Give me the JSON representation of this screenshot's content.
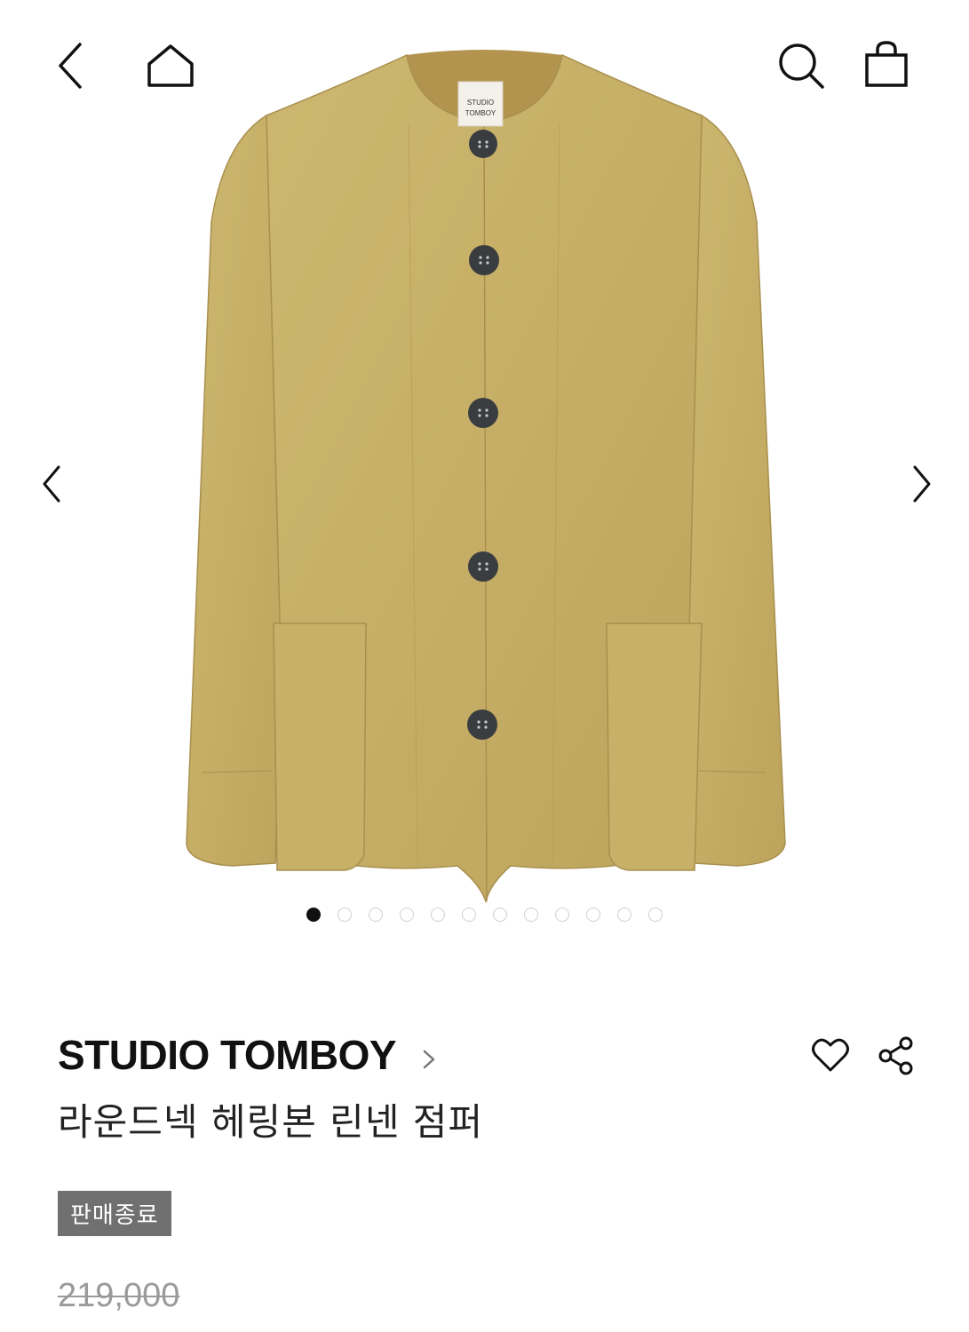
{
  "header": {
    "back_icon": "chevron-left-icon",
    "home_icon": "home-icon",
    "search_icon": "search-icon",
    "cart_icon": "shopping-bag-icon"
  },
  "gallery": {
    "image_label_line1": "STUDIO",
    "image_label_line2": "TOMBOY",
    "prev_icon": "chevron-left-icon",
    "next_icon": "chevron-right-icon",
    "slide_count": 12,
    "active_slide": 1
  },
  "product": {
    "brand": "STUDIO TOMBOY",
    "name": "라운드넥 헤링본 린넨 점퍼",
    "status_badge": "판매종료",
    "price": "219,000"
  },
  "colors": {
    "jacket": "#c9b36a",
    "badge_bg": "#707070",
    "price_gray": "#9a9a9a"
  }
}
